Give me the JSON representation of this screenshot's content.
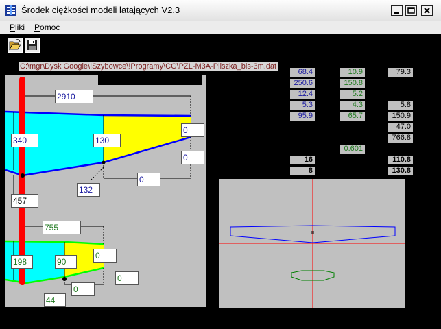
{
  "window": {
    "title": "Środek ciężkości modeli latających V2.3"
  },
  "menu": {
    "pliki_first": "P",
    "pliki_rest": "liki",
    "pomoc_first": "P",
    "pomoc_rest": "omoc"
  },
  "toolbar": {
    "open_icon": "open-folder-icon",
    "save_icon": "save-disk-icon"
  },
  "file_path": "C:\\mgr\\Dysk Google\\!Szybowce\\!Programy\\CG\\PZL-M3A-Pliszka_bis-3m.dat",
  "wing": {
    "span": "2910",
    "root_chord": "340",
    "mid_chord": "130",
    "tip_offset_upper": "0",
    "tip_offset_lower": "0",
    "sweep_offset": "0",
    "break_position": "132",
    "distance_tail": "457"
  },
  "tail": {
    "span": "755",
    "root_chord": "198",
    "mid_chord": "90",
    "tip_offset_upper": "0",
    "tip_offset_lower": "0",
    "sweep_offset": "0",
    "break_position": "44"
  },
  "results": {
    "col1": [
      "68.4",
      "250.6",
      "12.4",
      "5.3",
      "95.9"
    ],
    "col2": [
      "10.9",
      "150.8",
      "5.2",
      "4.3",
      "65.7",
      "0.601"
    ],
    "col3": [
      "79.3",
      "5.8",
      "150.9",
      "47.0",
      "766.8"
    ],
    "mid_bold": [
      "16",
      "8"
    ],
    "right_bold": [
      "110.8",
      "130.8"
    ]
  },
  "colors": {
    "wing_fill": "#00ffff",
    "tail_fill": "#ffff00",
    "outline_blue": "#0000ff",
    "outline_green": "#00ff00",
    "spar_red": "#ff0000"
  }
}
